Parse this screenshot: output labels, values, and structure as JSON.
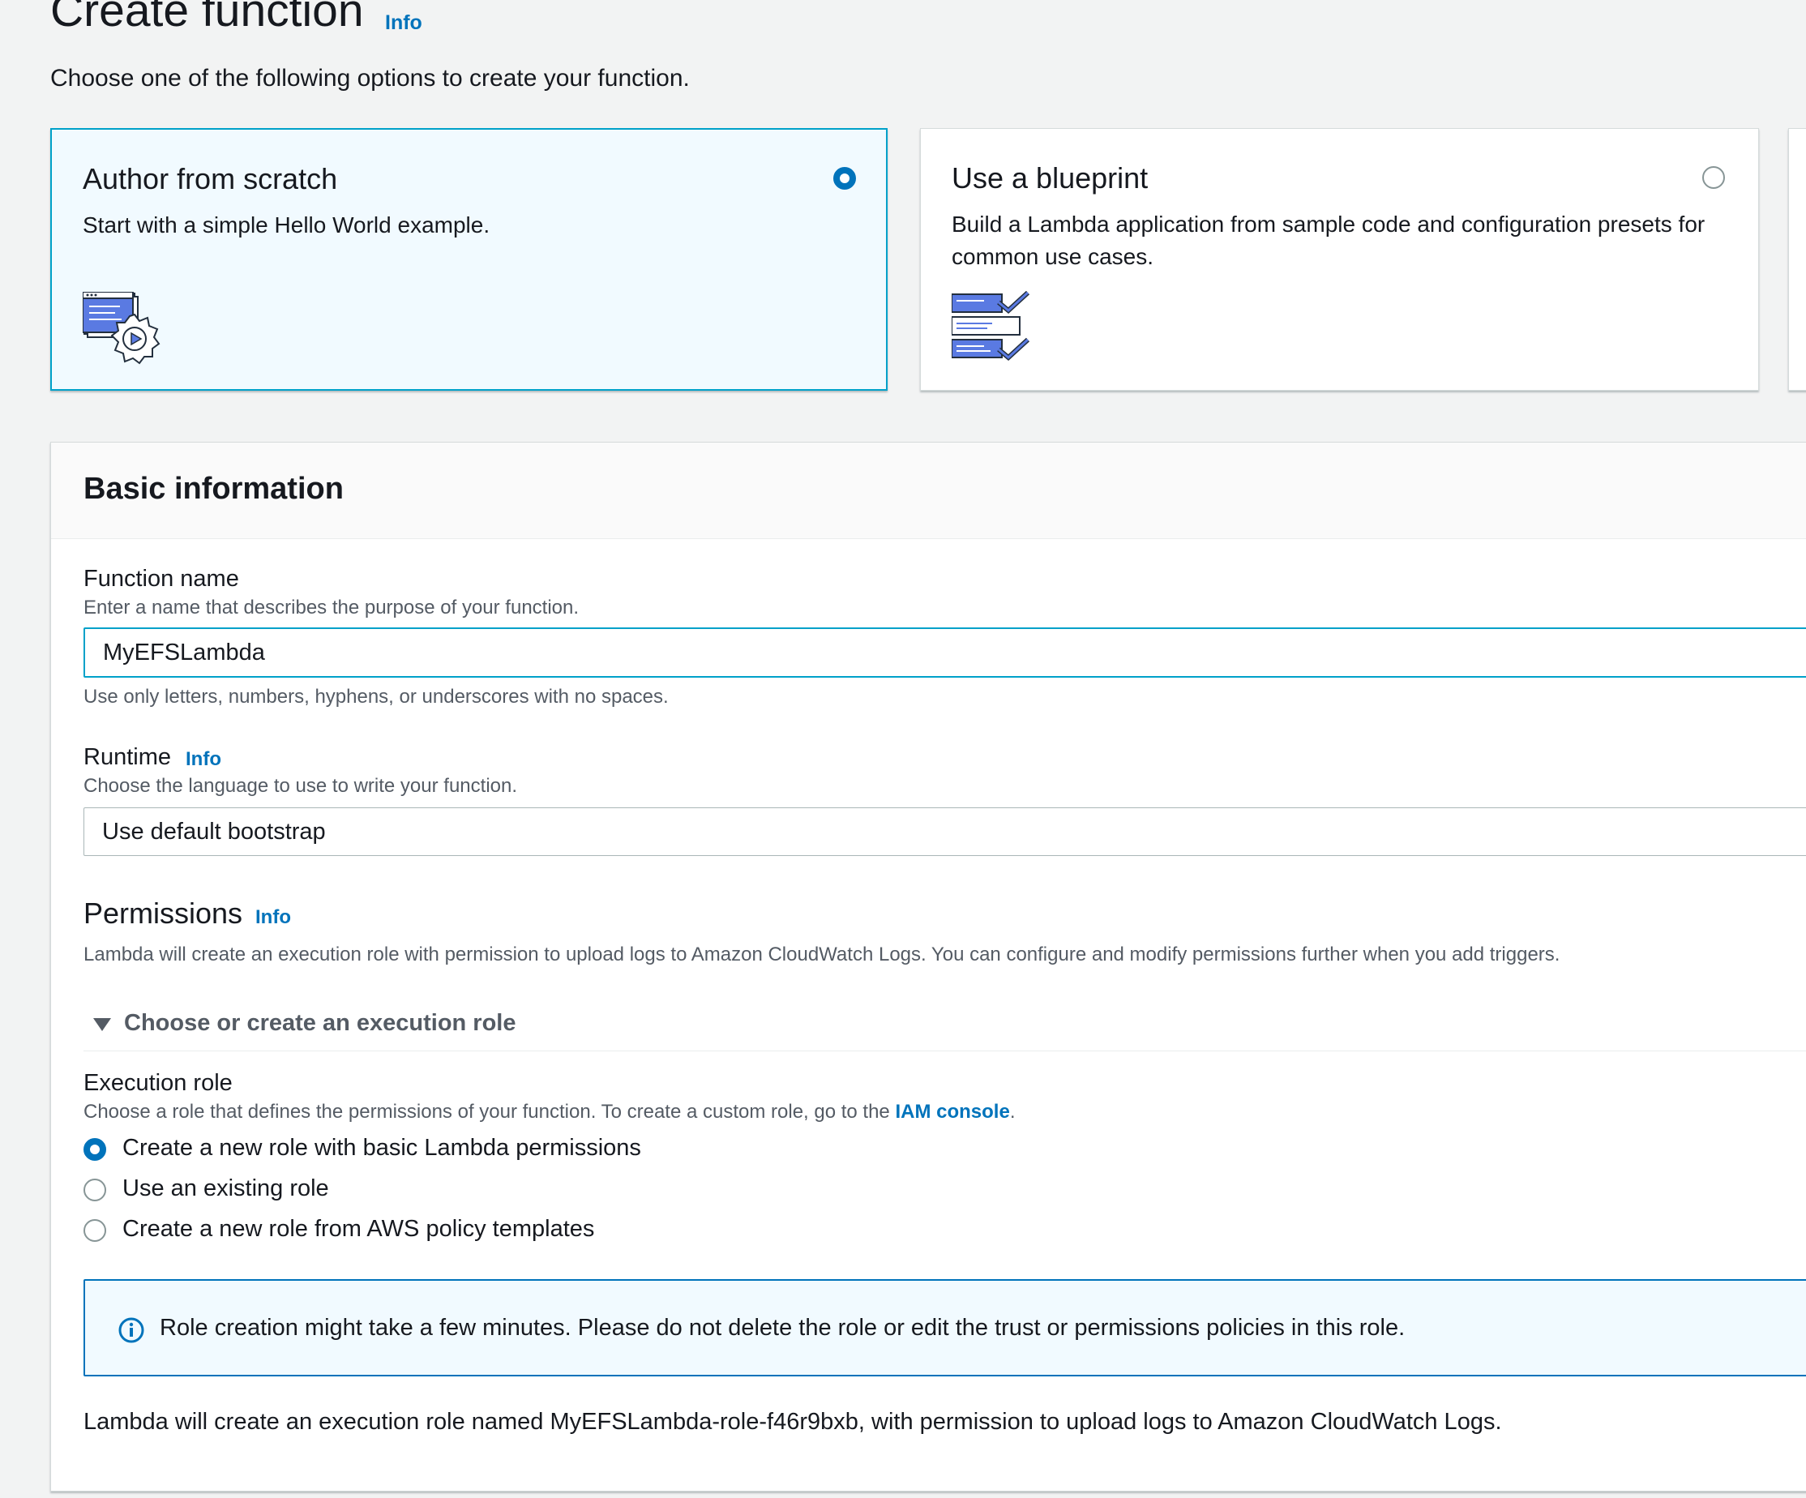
{
  "page": {
    "title": "Create function",
    "info_label": "Info",
    "subtitle": "Choose one of the following options to create your function."
  },
  "options": [
    {
      "title": "Author from scratch",
      "description": "Start with a simple Hello World example.",
      "selected": true,
      "icon": "code-gear-icon"
    },
    {
      "title": "Use a blueprint",
      "description": "Build a Lambda application from sample code and configuration presets for common use cases.",
      "selected": false,
      "icon": "checklist-icon"
    }
  ],
  "basic_info": {
    "title": "Basic information",
    "function_name": {
      "label": "Function name",
      "description": "Enter a name that describes the purpose of your function.",
      "value": "MyEFSLambda",
      "constraint": "Use only letters, numbers, hyphens, or underscores with no spaces."
    },
    "runtime": {
      "label": "Runtime",
      "info_label": "Info",
      "description": "Choose the language to use to write your function.",
      "value": "Use default bootstrap"
    }
  },
  "permissions": {
    "title": "Permissions",
    "info_label": "Info",
    "description": "Lambda will create an execution role with permission to upload logs to Amazon CloudWatch Logs. You can configure and modify permissions further when you add triggers.",
    "expander_label": "Choose or create an execution role",
    "execution_role": {
      "label": "Execution role",
      "description_prefix": "Choose a role that defines the permissions of your function. To create a custom role, go to the ",
      "iam_link": "IAM console",
      "description_suffix": ".",
      "options": [
        {
          "label": "Create a new role with basic Lambda permissions",
          "selected": true
        },
        {
          "label": "Use an existing role",
          "selected": false
        },
        {
          "label": "Create a new role from AWS policy templates",
          "selected": false
        }
      ]
    },
    "alert_text": "Role creation might take a few minutes. Please do not delete the role or edit the trust or permissions policies in this role.",
    "final_text": "Lambda will create an execution role named MyEFSLambda-role-f46r9bxb, with permission to upload logs to Amazon CloudWatch Logs."
  },
  "colors": {
    "accent": "#0073bb",
    "selected_border": "#00a1c9",
    "selected_bg": "#f1faff",
    "background": "#f2f3f3"
  }
}
